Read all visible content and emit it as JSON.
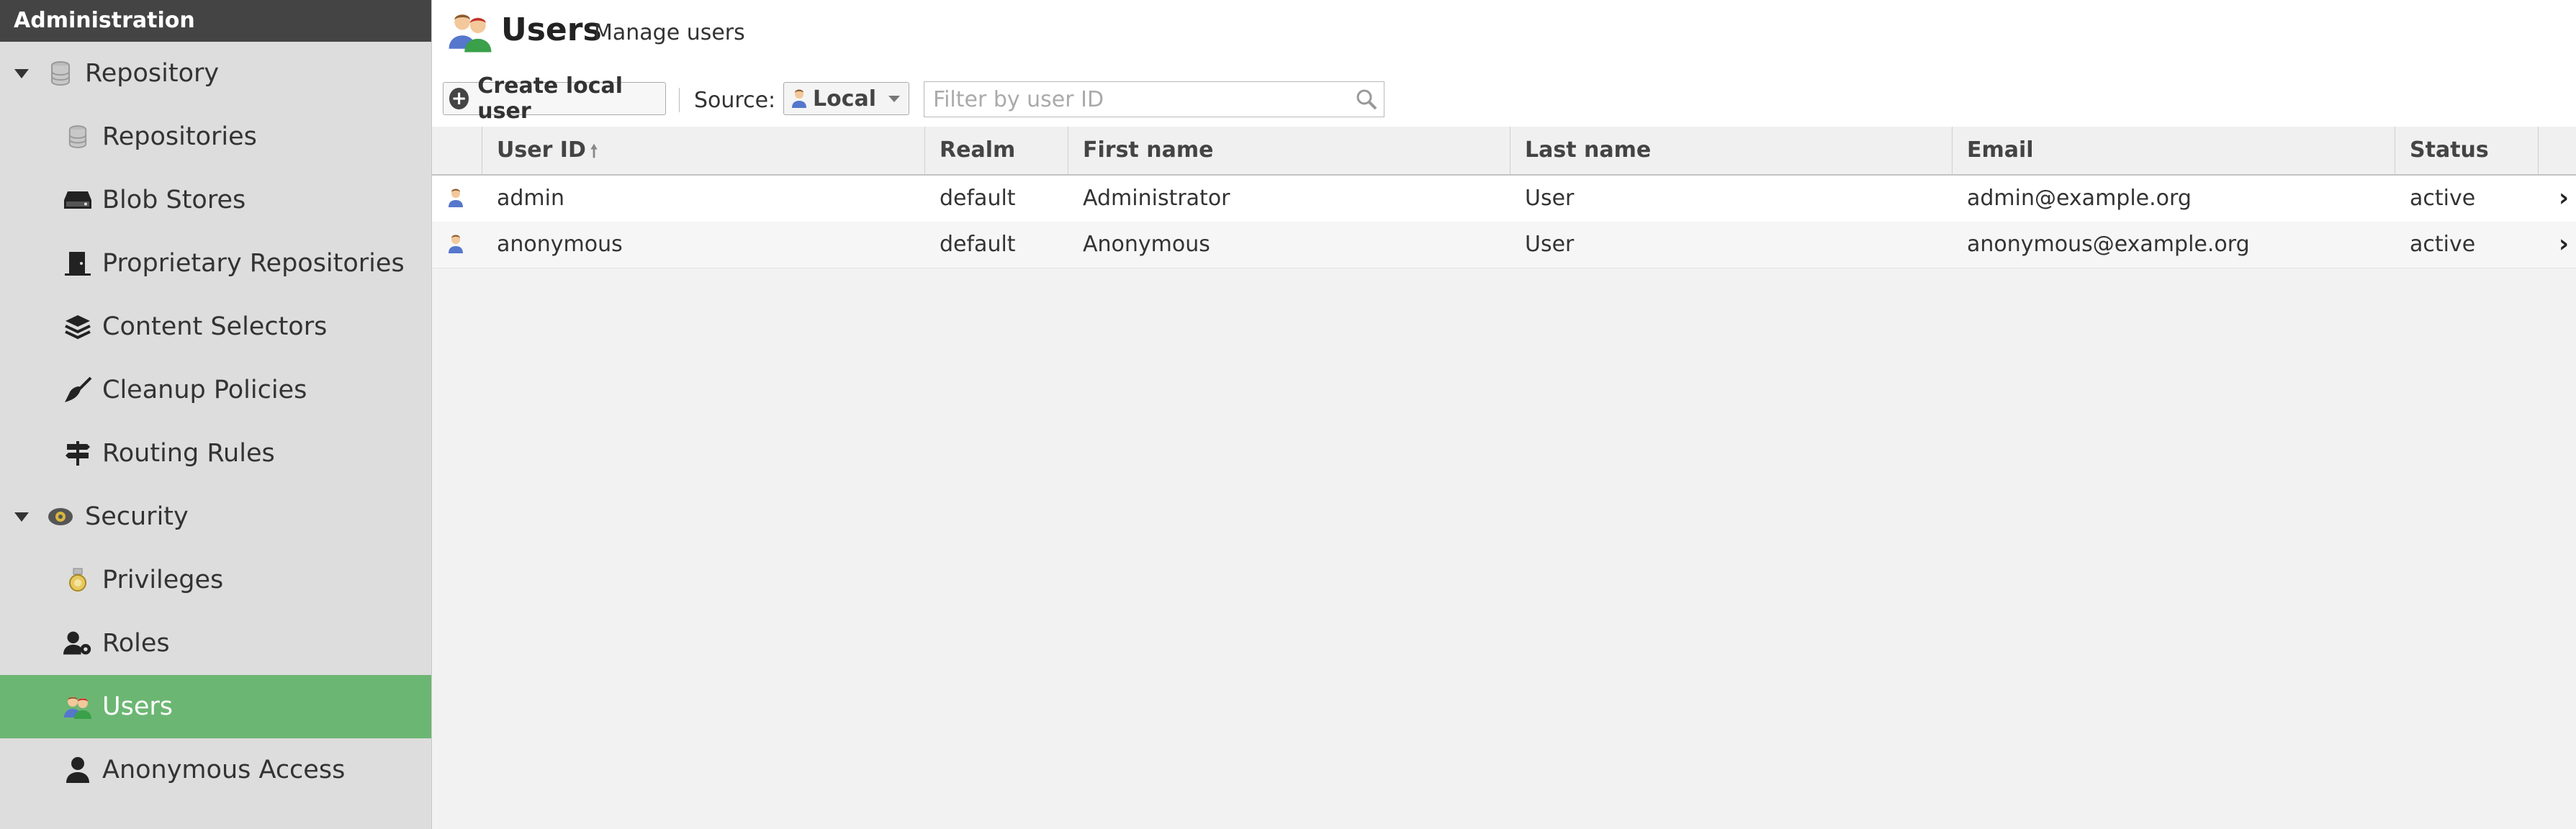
{
  "sidebar": {
    "header": "Administration",
    "groups": [
      {
        "label": "Repository",
        "icon": "database-icon",
        "items": [
          {
            "label": "Repositories",
            "icon": "database-icon"
          },
          {
            "label": "Blob Stores",
            "icon": "hard-drive-icon"
          },
          {
            "label": "Proprietary Repositories",
            "icon": "door-icon"
          },
          {
            "label": "Content Selectors",
            "icon": "layers-icon"
          },
          {
            "label": "Cleanup Policies",
            "icon": "broom-icon"
          },
          {
            "label": "Routing Rules",
            "icon": "signpost-icon"
          }
        ]
      },
      {
        "label": "Security",
        "icon": "security-badge-icon",
        "items": [
          {
            "label": "Privileges",
            "icon": "medal-icon"
          },
          {
            "label": "Roles",
            "icon": "user-gear-icon"
          },
          {
            "label": "Users",
            "icon": "users-icon",
            "selected": true
          },
          {
            "label": "Anonymous Access",
            "icon": "user-icon"
          }
        ]
      }
    ],
    "selected_color": "#6cb673"
  },
  "page": {
    "title": "Users",
    "subtitle": "Manage users"
  },
  "toolbar": {
    "create_label": "Create local user",
    "source_label": "Source:",
    "source_value": "Local",
    "filter_placeholder": "Filter by user ID",
    "filter_value": ""
  },
  "table": {
    "columns": [
      "User ID",
      "Realm",
      "First name",
      "Last name",
      "Email",
      "Status"
    ],
    "sorted_column": "User ID",
    "sort_direction": "ascending",
    "rows": [
      {
        "user_id": "admin",
        "realm": "default",
        "first_name": "Administrator",
        "last_name": "User",
        "email": "admin@example.org",
        "status": "active"
      },
      {
        "user_id": "anonymous",
        "realm": "default",
        "first_name": "Anonymous",
        "last_name": "User",
        "email": "anonymous@example.org",
        "status": "active"
      }
    ]
  }
}
